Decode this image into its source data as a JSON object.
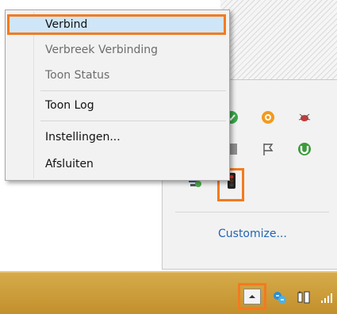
{
  "context_menu": {
    "items": [
      {
        "label": "Verbind",
        "enabled": true,
        "highlighted": true
      },
      {
        "label": "Verbreek Verbinding",
        "enabled": false
      },
      {
        "label": "Toon Status",
        "enabled": false
      },
      {
        "label": "Toon Log",
        "enabled": true
      },
      {
        "label": "Instellingen...",
        "enabled": true
      },
      {
        "label": "Afsluiten",
        "enabled": true
      }
    ]
  },
  "tray_overflow": {
    "customize_label": "Customize...",
    "icons": [
      "messenger-icon",
      "avast-icon",
      "bug-icon",
      "gray-square-icon",
      "flag-icon",
      "utorrent-icon",
      "network-shield-icon",
      "traffic-light-icon"
    ]
  },
  "colors": {
    "accent_highlight": "#f47a20",
    "menu_highlight_bg": "#cfe6f8",
    "link": "#1f65b5",
    "taskbar": "#c9973a"
  }
}
